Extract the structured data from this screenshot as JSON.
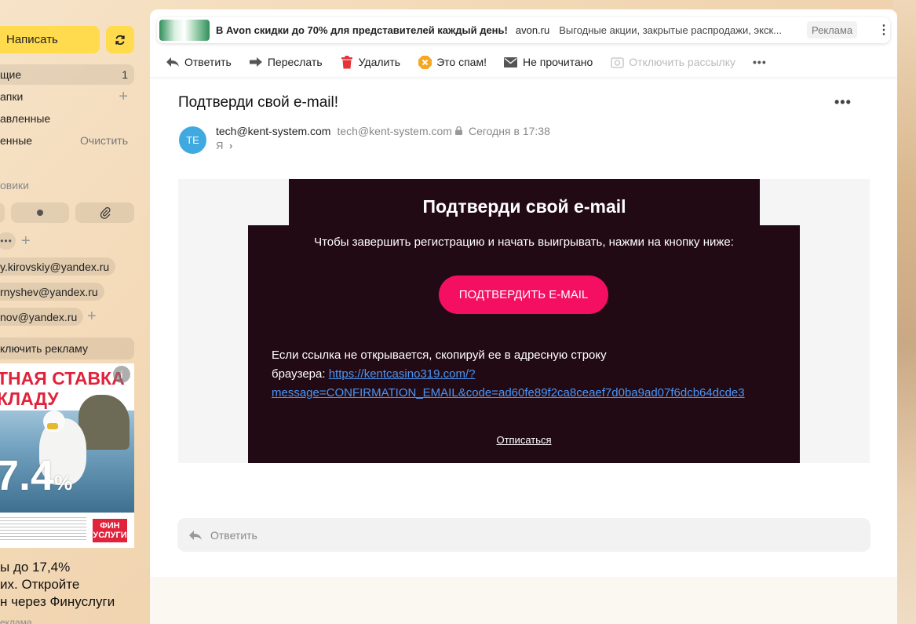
{
  "sidebar": {
    "compose_label": "Написать",
    "folders": [
      {
        "label": "щие",
        "right": "1"
      },
      {
        "label": "апки",
        "right": "+"
      },
      {
        "label": "авленные",
        "right": ""
      },
      {
        "label": "енные",
        "right": "Очистить"
      }
    ],
    "section_title": "овики",
    "contacts": [
      "y.kirovskiy@yandex.ru",
      "rnyshev@yandex.ru",
      "nov@yandex.ru"
    ],
    "disable_ads": "ключить рекламу",
    "ad": {
      "headline_line1": "ТНАЯ СТАВКА",
      "headline_line2": "КЛАДУ",
      "percent": "7.4",
      "percent_sign": "%",
      "badge_line1": "ФИН",
      "badge_line2": "УСЛУГИ",
      "text": "ы до 17,4%\nих. Откройте\nн через Финуслуги",
      "label": "еклама"
    }
  },
  "promo": {
    "title": "В Avon скидки до 70% для представителей каждый день!",
    "domain": "avon.ru",
    "description": "Выгодные акции, закрытые распродажи, экск...",
    "label": "Реклама"
  },
  "toolbar": {
    "reply": "Ответить",
    "forward": "Переслать",
    "delete": "Удалить",
    "spam": "Это спам!",
    "unread": "Не прочитано",
    "unsubscribe": "Отключить рассылку"
  },
  "message": {
    "subject": "Подтверди свой e-mail!",
    "avatar_initials": "TE",
    "sender_name": "tech@kent-system.com",
    "sender_email": "tech@kent-system.com",
    "date": "Сегодня в 17:38",
    "to": "Я"
  },
  "email": {
    "title": "Подтверди свой e-mail",
    "intro": "Чтобы завершить регистрацию и начать выигрывать, нажми на кнопку ниже:",
    "button": "ПОДТВЕРДИТЬ E-MAIL",
    "fallback_text_1": "Если ссылка не открывается, скопируй ее в адресную строку",
    "fallback_text_2": "браузера: ",
    "link_part1": "https://kentcasino319.com/?",
    "link_part2": "message=CONFIRMATION_EMAIL&code=ad60fe89f2ca8ceaef7d0ba9ad07f6dcb64dcde3",
    "unsubscribe": "Отписаться"
  },
  "reply_box": {
    "placeholder": "Ответить"
  },
  "colors": {
    "accent_yellow": "#ffdb4d",
    "email_bg": "#220a14",
    "confirm_button": "#f50f63",
    "link": "#4a95f5",
    "avatar": "#3fa9e0"
  }
}
